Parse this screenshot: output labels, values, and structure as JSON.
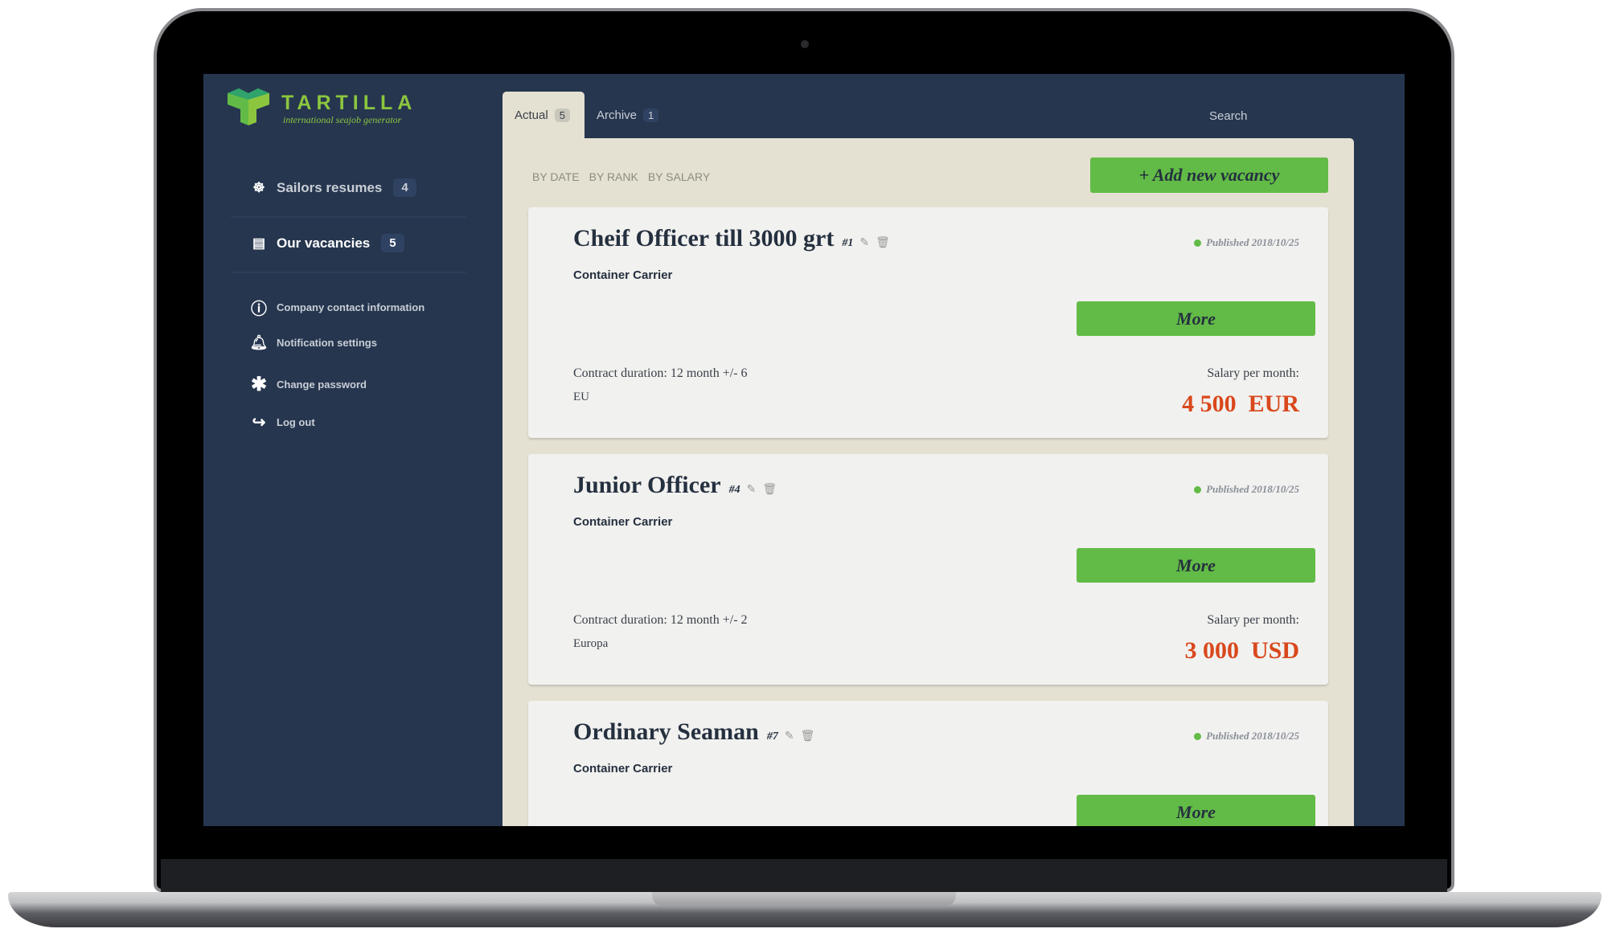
{
  "brand": {
    "name": "TARTILLA",
    "tagline": "international seajob generator"
  },
  "sidebar": {
    "items": [
      {
        "label": "Sailors resumes",
        "count": "4",
        "icon": "ship-wheel-icon"
      },
      {
        "label": "Our vacancies",
        "count": "5",
        "icon": "document-icon"
      },
      {
        "label": "Company contact information",
        "icon": "info-icon"
      },
      {
        "label": "Notification settings",
        "icon": "bell-icon"
      },
      {
        "label": "Change password",
        "icon": "asterisk-icon"
      },
      {
        "label": "Log out",
        "icon": "logout-icon"
      }
    ]
  },
  "tabs": [
    {
      "label": "Actual",
      "count": "5"
    },
    {
      "label": "Archive",
      "count": "1"
    }
  ],
  "search": {
    "label": "Search"
  },
  "sort": [
    "BY DATE",
    "BY RANK",
    "BY SALARY"
  ],
  "add_button": "+ Add new vacancy",
  "vacancies": [
    {
      "title": "Cheif Officer till 3000 grt",
      "id": "#1",
      "published": "Published 2018/10/25",
      "type": "Container Carrier",
      "more": "More",
      "duration": "Contract duration: 12 month +/- 6",
      "region": "EU",
      "salary_label": "Salary per month:",
      "salary": "4 500  EUR"
    },
    {
      "title": "Junior Officer",
      "id": "#4",
      "published": "Published 2018/10/25",
      "type": "Container Carrier",
      "more": "More",
      "duration": "Contract duration: 12 month +/- 2",
      "region": "Europa",
      "salary_label": "Salary per month:",
      "salary": "3 000  USD"
    },
    {
      "title": "Ordinary Seaman",
      "id": "#7",
      "published": "Published 2018/10/25",
      "type": "Container Carrier",
      "more": "More"
    }
  ],
  "colors": {
    "sidebar": "#26364f",
    "accent": "#62bb46",
    "salary": "#d9481c",
    "panel": "#e4e1d2"
  }
}
